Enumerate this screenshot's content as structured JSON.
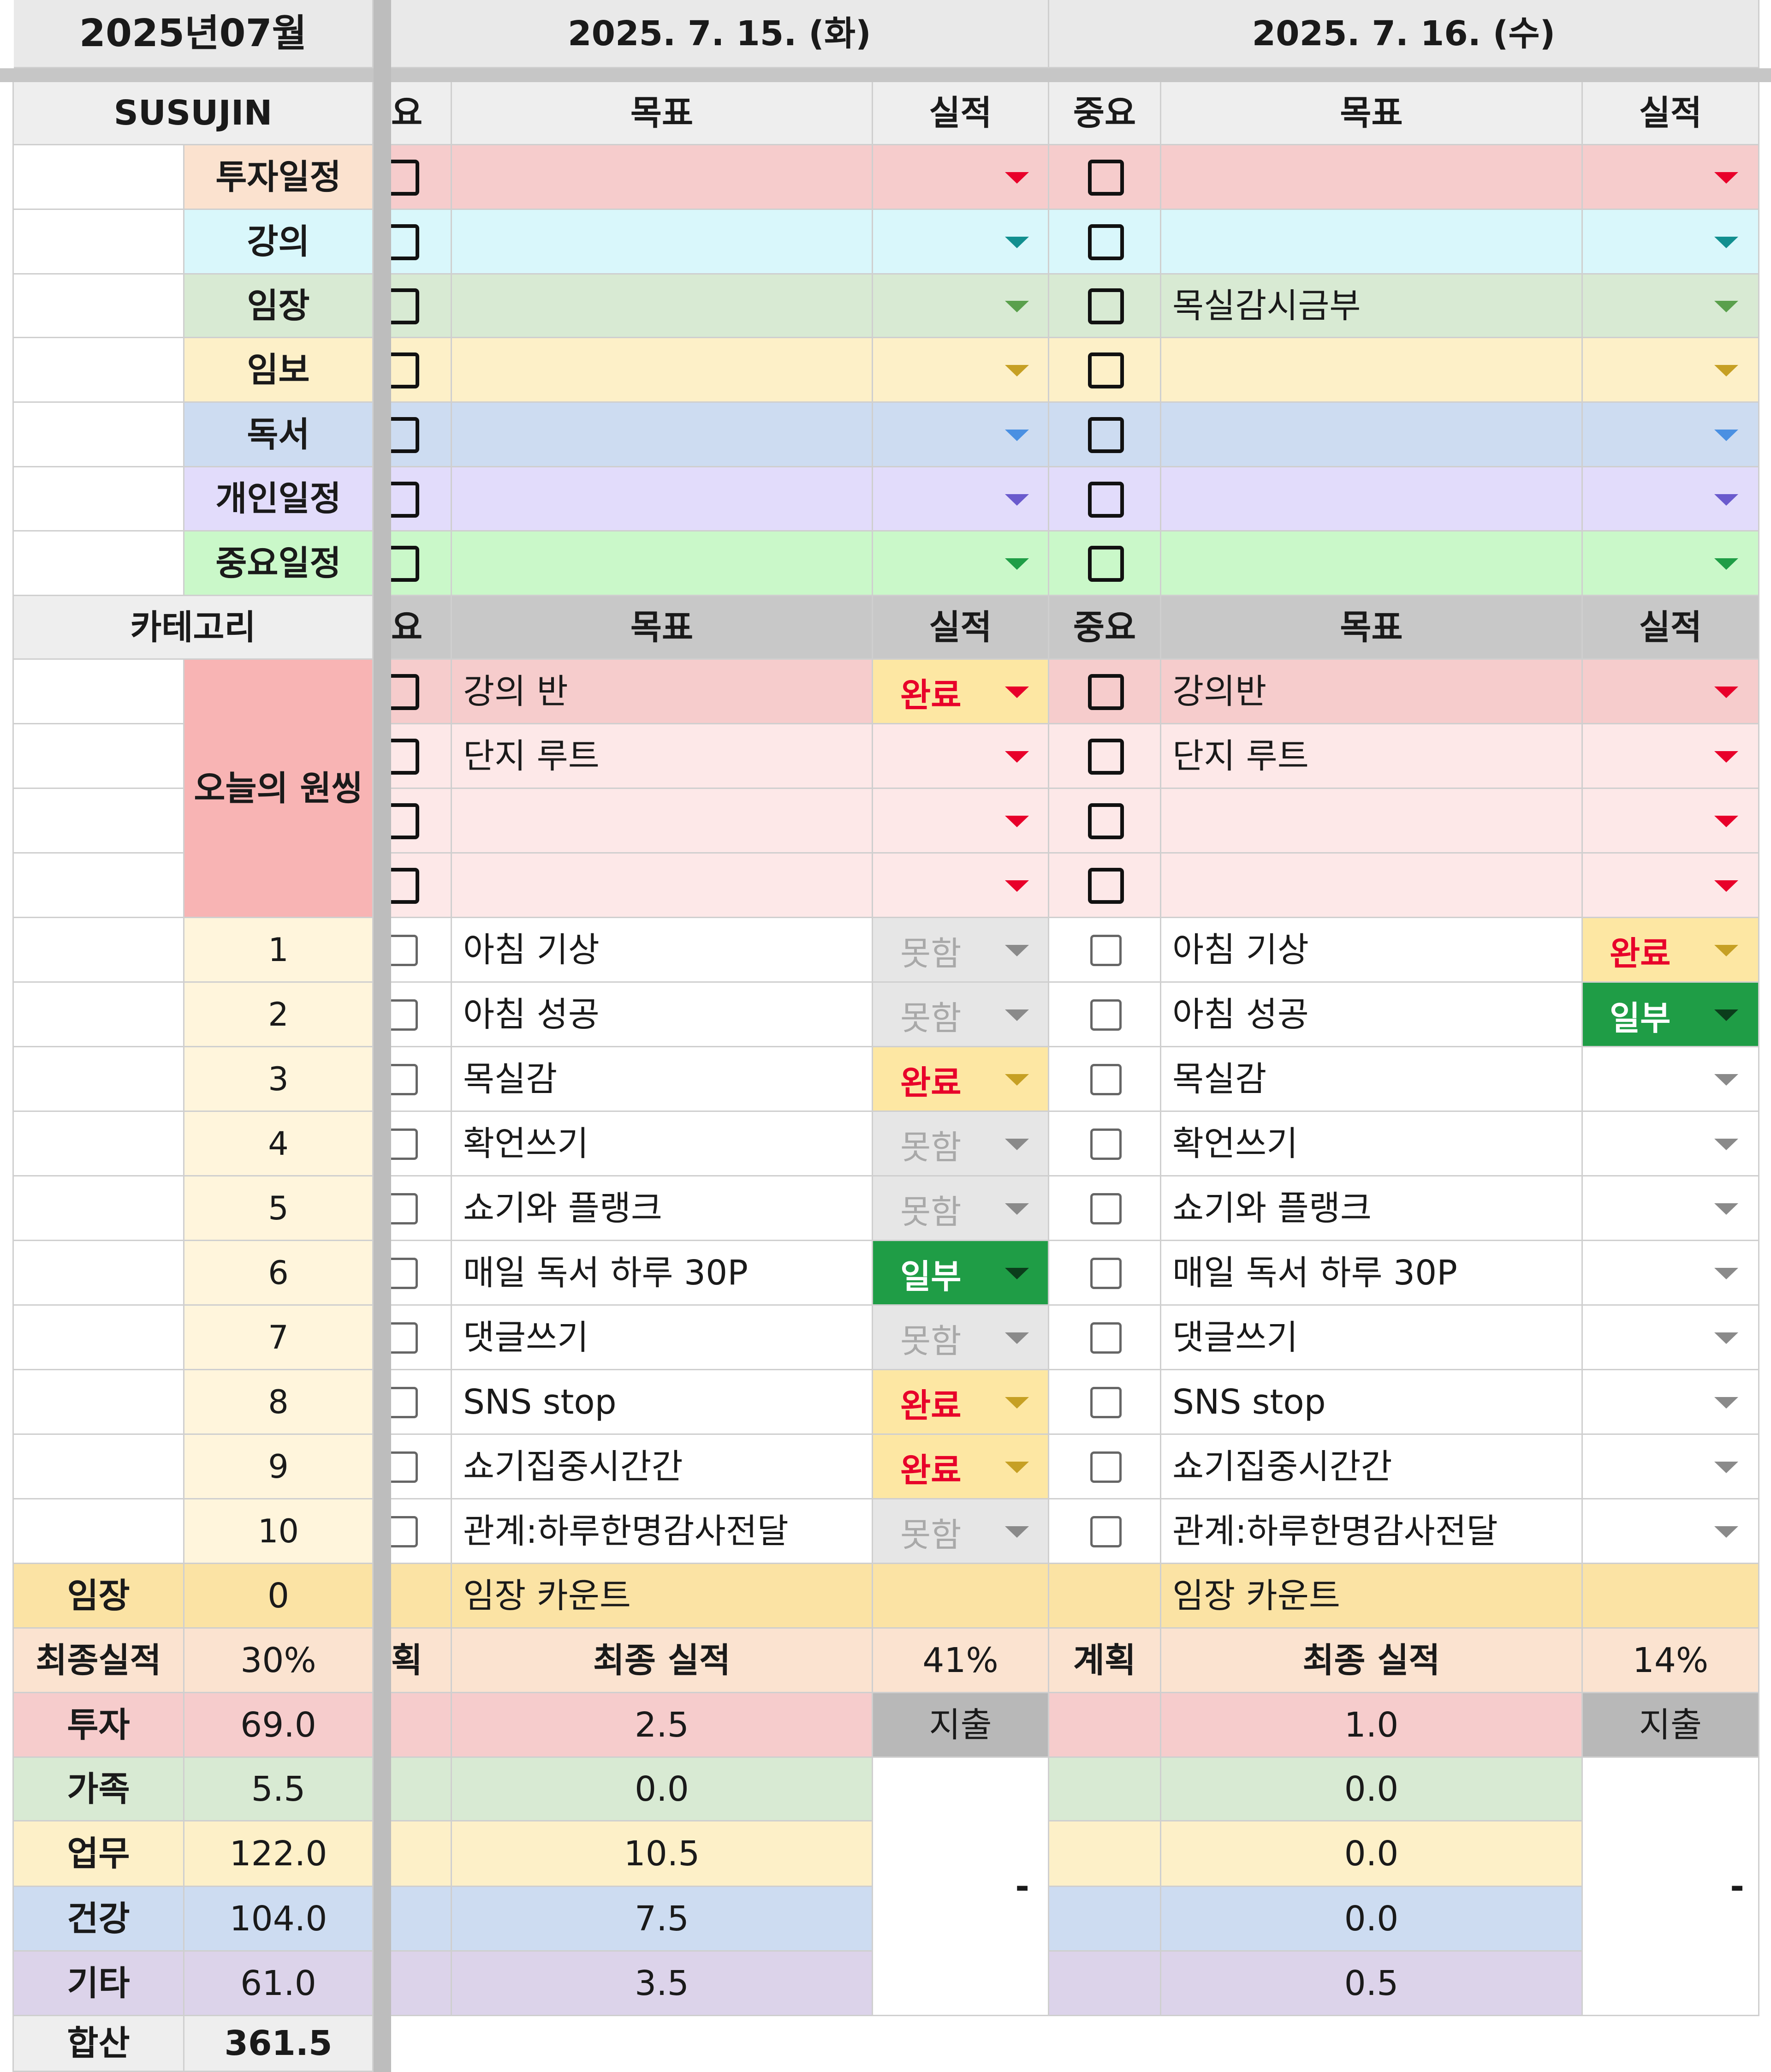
{
  "colors": {
    "invest_bg": "#f6cccc",
    "lecture_bg": "#d9f7fb",
    "field_bg": "#d8ead3",
    "imbo_bg": "#fdf0c8",
    "reading_bg": "#cddcf1",
    "personal_bg": "#e2dcfb",
    "important_bg": "#caf8c9",
    "header_bg": "#eeeeee",
    "onething_label_bg": "#f8b4b4",
    "onething_row_bg": "#fde8e8",
    "routine_label_bg": "#fff5dc",
    "done_pill_bg": "#fde7a3",
    "partial_pill_bg": "#1f9d46",
    "notdone_pill_bg": "#e6e6e6",
    "gold_bg": "#fbe3a4",
    "final_bg": "#fbe3d0",
    "expense_btn_bg": "#b8b8b8",
    "invest_color": "#e8002a",
    "lecture_color": "#128f8f",
    "field_color": "#5aa04c",
    "imbo_color": "#c6a024",
    "reading_color": "#4a90e2",
    "personal_color": "#6a5acd",
    "important_color": "#1f9d46"
  },
  "header": {
    "month": "2025년07월",
    "day1_date": "2025. 7. 15. (화)",
    "day2_date": "2025. 7. 16. (수)"
  },
  "section1": {
    "owner": "SUSUJIN",
    "col_importance_trunc": "요",
    "col_importance": "중요",
    "col_goal": "목표",
    "col_result": "실적",
    "categories": [
      "투자일정",
      "강의",
      "임장",
      "임보",
      "독서",
      "개인일정",
      "중요일정"
    ],
    "day1_goals": [
      "",
      "",
      "",
      "",
      "",
      "",
      ""
    ],
    "day2_goals": [
      "",
      "",
      "목실감시금부",
      "",
      "",
      "",
      ""
    ]
  },
  "section2": {
    "category_label": "카테고리",
    "col_importance_trunc": "요",
    "col_importance": "중요",
    "col_goal": "목표",
    "col_result": "실적",
    "onething_label": "오늘의 원씽",
    "day1_onething": [
      "강의 반",
      "단지 루트",
      "",
      ""
    ],
    "day1_onething_results": [
      "완료",
      "",
      "",
      ""
    ],
    "day2_onething": [
      "강의반",
      "단지 루트",
      "",
      ""
    ],
    "routine_numbers": [
      "1",
      "2",
      "3",
      "4",
      "5",
      "6",
      "7",
      "8",
      "9",
      "10"
    ],
    "routines": [
      "아침 기상",
      "아침 성공",
      "목실감",
      "확언쓰기",
      "쇼기와 플랭크",
      "매일 독서 하루 30P",
      "댓글쓰기",
      "SNS stop",
      "쇼기집중시간간",
      "관계:하루한명감사전달"
    ],
    "day1_results": [
      "못함",
      "못함",
      "완료",
      "못함",
      "못함",
      "일부",
      "못함",
      "완료",
      "완료",
      "못함"
    ],
    "day2_results": [
      "완료",
      "일부",
      "",
      "",
      "",
      "",
      "",
      "",
      "",
      ""
    ]
  },
  "summary": {
    "field_label": "임장",
    "field_value": "0",
    "field_count_label": "임장 카운트",
    "final_label": "최종실적",
    "final_value": "30%",
    "plan_trunc": "획",
    "plan_label": "계획",
    "final_result_label": "최종 실적",
    "day1_final": "41%",
    "day2_final": "14%",
    "expense_button": "지출",
    "expense_dash": "-",
    "rows": [
      {
        "label": "투자",
        "total": "69.0",
        "day1": "2.5",
        "day2": "1.0"
      },
      {
        "label": "가족",
        "total": "5.5",
        "day1": "0.0",
        "day2": "0.0"
      },
      {
        "label": "업무",
        "total": "122.0",
        "day1": "10.5",
        "day2": "0.0"
      },
      {
        "label": "건강",
        "total": "104.0",
        "day1": "7.5",
        "day2": "0.0"
      },
      {
        "label": "기타",
        "total": "61.0",
        "day1": "3.5",
        "day2": "0.5"
      }
    ],
    "sum_label": "합산",
    "sum_value": "361.5"
  }
}
